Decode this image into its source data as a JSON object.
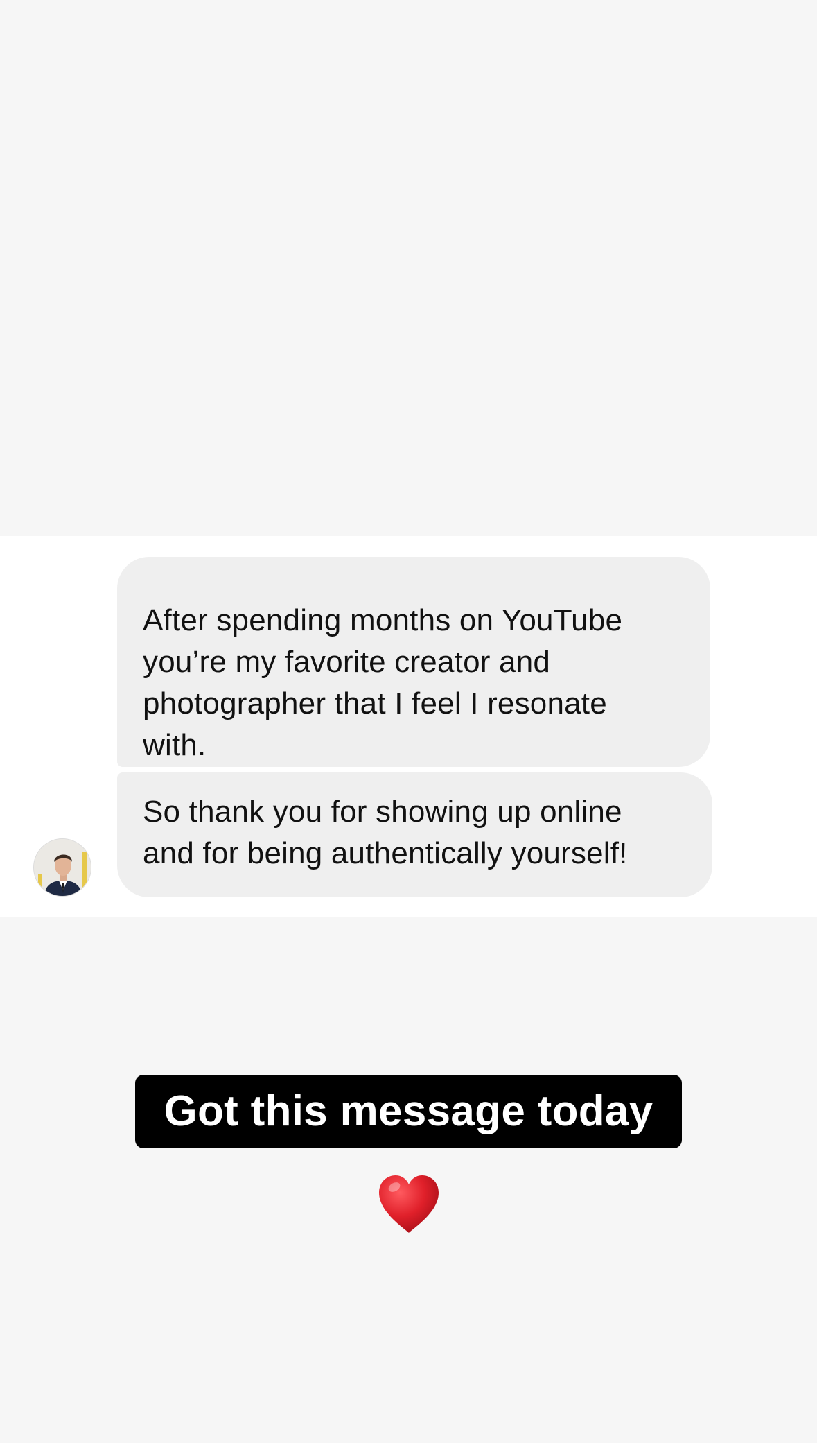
{
  "messages": [
    {
      "text": "After spending months on YouTube\nyou’re my favorite creator and\nphotographer that I feel I resonate\nwith."
    },
    {
      "text": "So thank you for showing up online\nand for being authentically yourself!"
    }
  ],
  "caption": "Got this message today",
  "reaction": {
    "icon": "red-heart-icon",
    "color": "#e0202a"
  },
  "colors": {
    "background": "#f6f6f6",
    "chat_strip": "#ffffff",
    "bubble": "#efefef",
    "caption_bg": "#000000",
    "caption_text": "#ffffff"
  }
}
